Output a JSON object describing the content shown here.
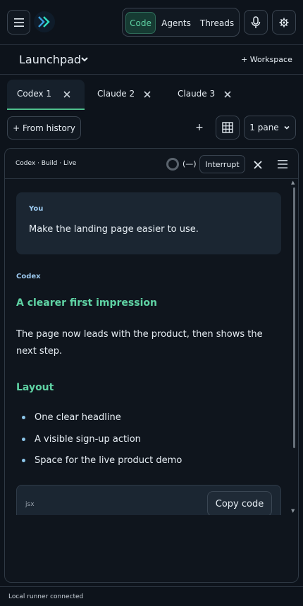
{
  "topbar": {
    "segments": [
      "Code",
      "Agents",
      "Threads"
    ]
  },
  "workspace": {
    "title": "Launchpad",
    "add_label": "+ Workspace"
  },
  "tabs": [
    {
      "label": "Codex 1"
    },
    {
      "label": "Claude 2"
    },
    {
      "label": "Claude 3"
    }
  ],
  "toolbar": {
    "from_history": "+  From history",
    "add_pane": "+",
    "pane_select": "1 pane"
  },
  "pane": {
    "title": "Codex · Build · Live",
    "status": "(—)",
    "interrupt": "Interrupt"
  },
  "conversation": {
    "user_role": "You",
    "user_text": "Make the landing page easier to use.",
    "assistant_role": "Codex",
    "heading1": "A clearer first impression",
    "paragraph": "The page now leads with the product, then shows the next step.",
    "heading2": "Layout",
    "bullets": [
      "One clear headline",
      "A visible sign-up action",
      "Space for the live product demo"
    ],
    "code_lang": "jsx",
    "copy_label": "Copy code"
  },
  "footer": {
    "status": "Local runner connected"
  },
  "colors": {
    "accent": "#5fd3a4",
    "role": "#9cc9ef",
    "background": "#0d131b"
  },
  "icons": [
    "hamburger-icon",
    "logo-icon",
    "microphone-icon",
    "gear-icon",
    "chevron-down-icon",
    "close-icon",
    "grid-icon",
    "spinner-icon",
    "menu-icon"
  ]
}
